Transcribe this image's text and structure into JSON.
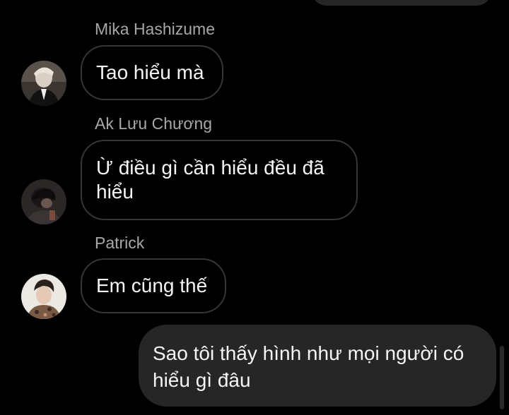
{
  "messages": [
    {
      "sender": "Mika Hashizume",
      "text": "Tao hiểu mà",
      "avatar": "avatar-mika"
    },
    {
      "sender": "Ak Lưu Chương",
      "text": "Ừ điều gì cần hiểu đều đã hiểu",
      "avatar": "avatar-ak"
    },
    {
      "sender": "Patrick",
      "text": "Em cũng thế",
      "avatar": "avatar-patrick"
    }
  ],
  "outgoing": {
    "text": "Sao tôi thấy hình như mọi người có hiểu gì đâu"
  },
  "colors": {
    "background": "#000000",
    "incoming_border": "#363636",
    "outgoing_bg": "#262626",
    "sender_name": "#a8a8a8",
    "message_text": "#f5f5f5"
  }
}
